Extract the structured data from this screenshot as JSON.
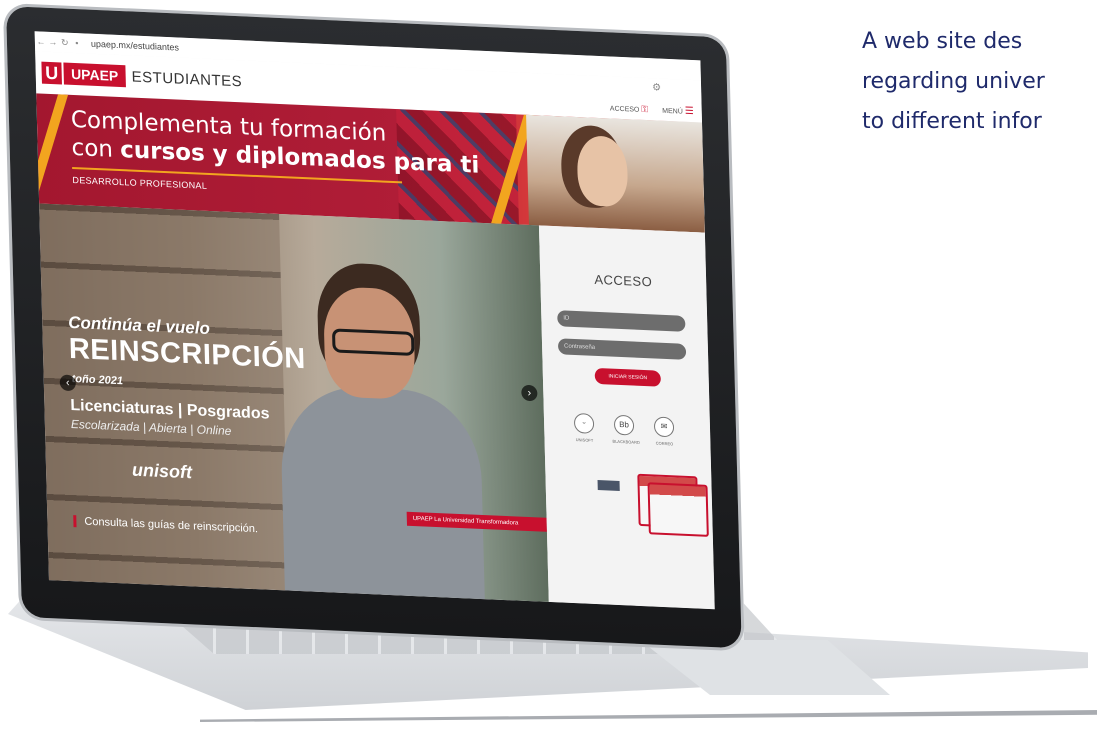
{
  "caption": {
    "line1": "A web site des",
    "line2": "regarding univer",
    "line3": "to different infor"
  },
  "browser": {
    "url": "upaep.mx/estudiantes"
  },
  "header": {
    "logo_letter": "U",
    "logo_name": "UPAEP",
    "section_title": "ESTUDIANTES",
    "acceso_label": "ACCESO",
    "menu_label": "MENÚ"
  },
  "banner": {
    "line1": "Complementa tu formación",
    "line2_prefix": "con ",
    "line2_bold": "cursos y diplomados para ti",
    "subtitle": "DESARROLLO PROFESIONAL"
  },
  "hero": {
    "kicker": "Continúa el vuelo",
    "title": "REINSCRIPCIÓN",
    "term": "toño 2021",
    "programs": "Licenciaturas | Posgrados",
    "modes": "Escolarizada | Abierta | Online",
    "brand": "unisoft",
    "guides_link": "Consulta las guías de reinscripción.",
    "tagline": "UPAEP La Universidad Transformadora"
  },
  "login": {
    "title": "ACCESO",
    "id_placeholder": "ID",
    "password_placeholder": "Contraseña",
    "submit_label": "INICIAR SESIÓN",
    "services": [
      {
        "label": "UNISOFT",
        "icon": "unisoft-icon",
        "glyph": "ᵕ"
      },
      {
        "label": "BLACKBOARD",
        "icon": "blackboard-icon",
        "glyph": "Bb"
      },
      {
        "label": "CORREO",
        "icon": "mail-icon",
        "glyph": "✉"
      }
    ]
  },
  "colors": {
    "brand_red": "#c8102e",
    "accent_orange": "#f2a51f",
    "caption_text": "#1f2a6b"
  }
}
